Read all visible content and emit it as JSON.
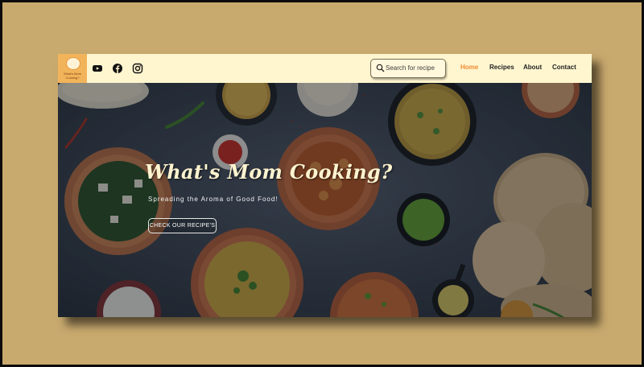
{
  "page": {
    "background_color": "#c8a96e",
    "navbar_color": "#fff6cf",
    "accent_color": "#f08a32"
  },
  "logo": {
    "text": "What's Mom Cooking?",
    "icon": "plate-logo-icon"
  },
  "social": [
    {
      "name": "youtube-icon"
    },
    {
      "name": "facebook-icon"
    },
    {
      "name": "instagram-icon"
    }
  ],
  "search": {
    "placeholder": "Search for recipe",
    "icon": "search-icon"
  },
  "nav": {
    "items": [
      {
        "label": "Home",
        "active": true
      },
      {
        "label": "Recipes",
        "active": false
      },
      {
        "label": "About",
        "active": false
      },
      {
        "label": "Contact",
        "active": false
      }
    ]
  },
  "hero": {
    "title": "What's Mom Cooking?",
    "subtitle": "Spreading the Aroma of Good Food!",
    "cta_label": "CHECK OUR RECIPE'S"
  }
}
